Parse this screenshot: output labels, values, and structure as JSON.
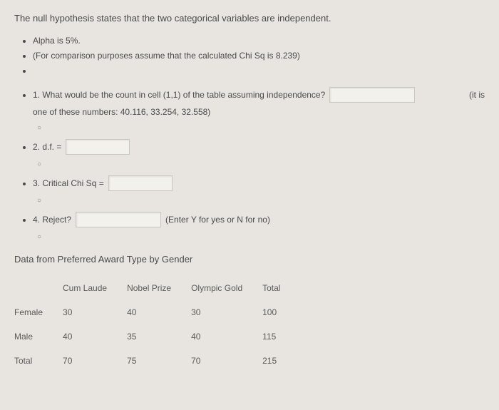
{
  "intro": "The null hypothesis states that the two categorical variables are independent.",
  "bullets": {
    "alpha": "Alpha is 5%.",
    "chi": "(For comparison purposes assume that the calculated Chi Sq is 8.239)"
  },
  "q1": {
    "text": "1. What would be the count in cell (1,1) of the table assuming independence?",
    "trail": "(it is",
    "sub": "one of these numbers: 40.116, 33.254, 32.558)"
  },
  "q2": {
    "label": "2. d.f. ="
  },
  "q3": {
    "label": "3. Critical Chi Sq ="
  },
  "q4": {
    "label": "4. Reject?",
    "hint": "(Enter Y for yes or N for no)"
  },
  "circle": "○",
  "table_title": "Data from Preferred Award Type by Gender",
  "chart_data": {
    "type": "table",
    "columns": [
      "",
      "Cum Laude",
      "Nobel Prize",
      "Olympic Gold",
      "Total"
    ],
    "rows": [
      {
        "label": "Female",
        "values": [
          30,
          40,
          30,
          100
        ]
      },
      {
        "label": "Male",
        "values": [
          40,
          35,
          40,
          115
        ]
      },
      {
        "label": "Total",
        "values": [
          70,
          75,
          70,
          215
        ]
      }
    ]
  }
}
